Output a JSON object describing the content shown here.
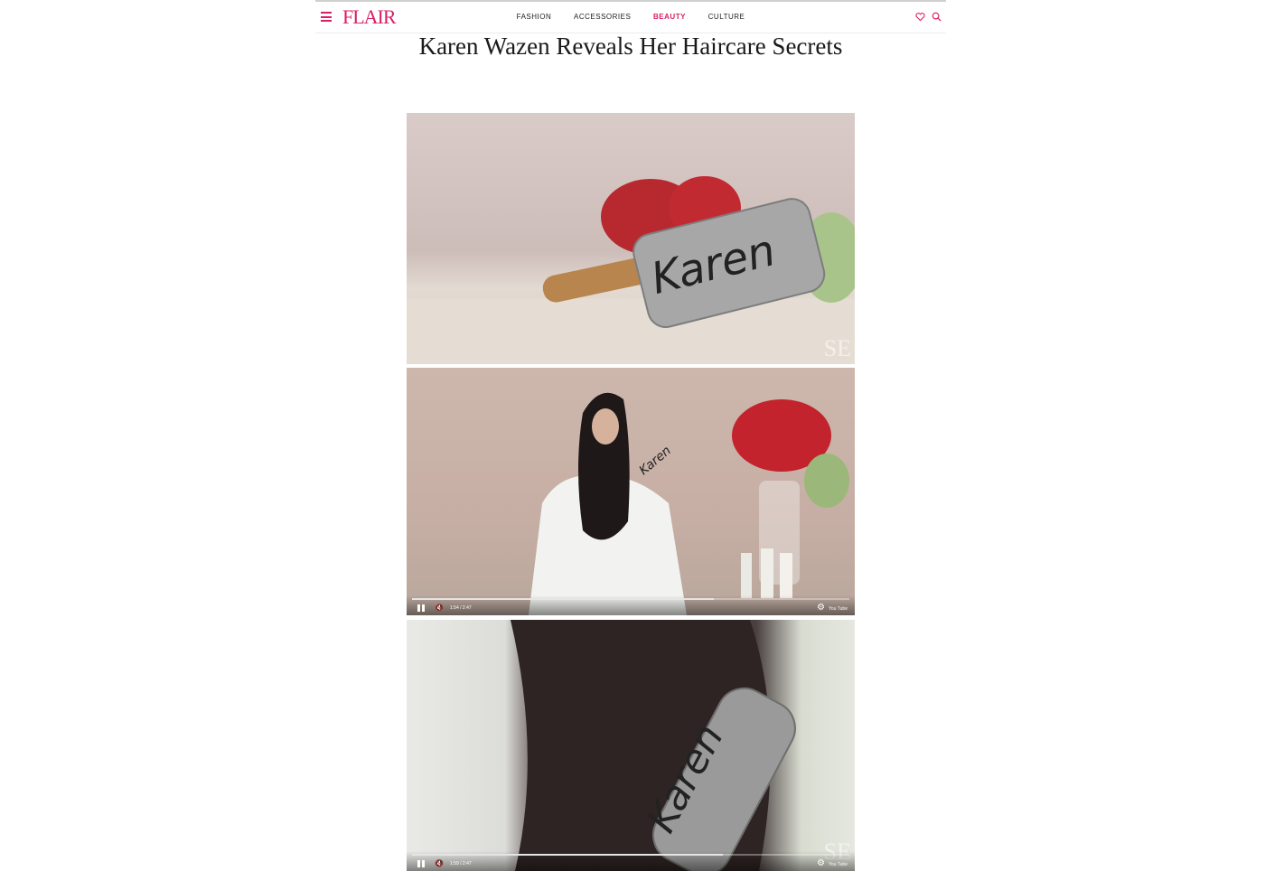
{
  "site": {
    "logo": "FLAIR"
  },
  "nav": {
    "items": [
      {
        "label": "FASHION",
        "active": false
      },
      {
        "label": "ACCESSORIES",
        "active": false
      },
      {
        "label": "BEAUTY",
        "active": true
      },
      {
        "label": "CULTURE",
        "active": false
      }
    ]
  },
  "icons": {
    "menu": "hamburger-menu-icon",
    "favorites": "heart-icon",
    "search": "search-icon"
  },
  "colors": {
    "brand": "#d81f65"
  },
  "article": {
    "title": "Karen Wazen Reveals Her Haircare Secrets",
    "images": [
      {
        "brush_text": "Karen",
        "watermark": "SE"
      },
      {
        "brush_text": "Karen"
      },
      {
        "brush_text": "Karen",
        "watermark": "SE"
      }
    ],
    "videos": [
      {
        "time": "1:54 / 2:47",
        "progress": 0.69,
        "youtube_label": "You Tube"
      },
      {
        "time": "1:59 / 2:47",
        "progress": 0.71,
        "youtube_label": "You Tube"
      }
    ]
  }
}
